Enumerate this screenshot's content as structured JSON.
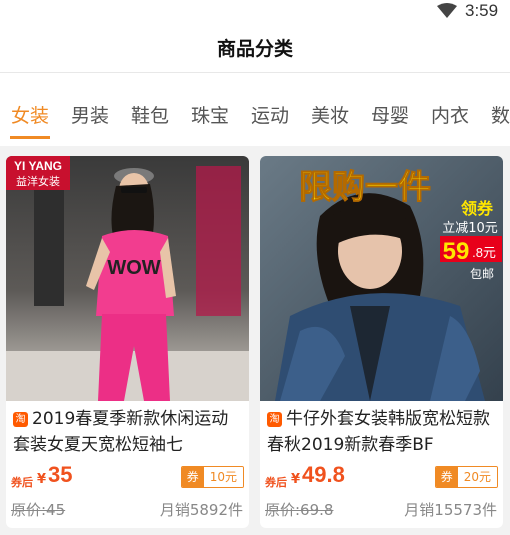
{
  "status_bar": {
    "time": "3:59",
    "wifi_icon": "wifi-icon"
  },
  "header": {
    "title": "商品分类"
  },
  "tabs": [
    {
      "label": "女装",
      "active": true
    },
    {
      "label": "男装"
    },
    {
      "label": "鞋包"
    },
    {
      "label": "珠宝"
    },
    {
      "label": "运动"
    },
    {
      "label": "美妆"
    },
    {
      "label": "母婴"
    },
    {
      "label": "内衣"
    },
    {
      "label": "数"
    }
  ],
  "colors": {
    "accent": "#f08a24",
    "price": "#f0521e"
  },
  "products": [
    {
      "title": "2019春夏季新款休闲运动套装女夏天宽松短袖七",
      "after_coupon_label": "券后",
      "currency": "¥",
      "price": "35",
      "coupon_tag": "券",
      "coupon_amount": "10元",
      "original_price": "原价:45",
      "sales": "月销5892件",
      "image": {
        "brand_en": "YI YANG",
        "brand_cn": "益洋女装",
        "shirt_text": "WOW"
      }
    },
    {
      "title": "牛仔外套女装韩版宽松短款春秋2019新款春季BF",
      "after_coupon_label": "券后",
      "currency": "¥",
      "price": "49.8",
      "coupon_tag": "券",
      "coupon_amount": "20元",
      "original_price": "原价:69.8",
      "sales": "月销15573件",
      "image": {
        "banner": "限购一件",
        "promo_title": "领券",
        "promo_sub": "立减10元",
        "promo_price": "59",
        "promo_price_dec": ".8元",
        "promo_ship": "包邮"
      }
    }
  ]
}
